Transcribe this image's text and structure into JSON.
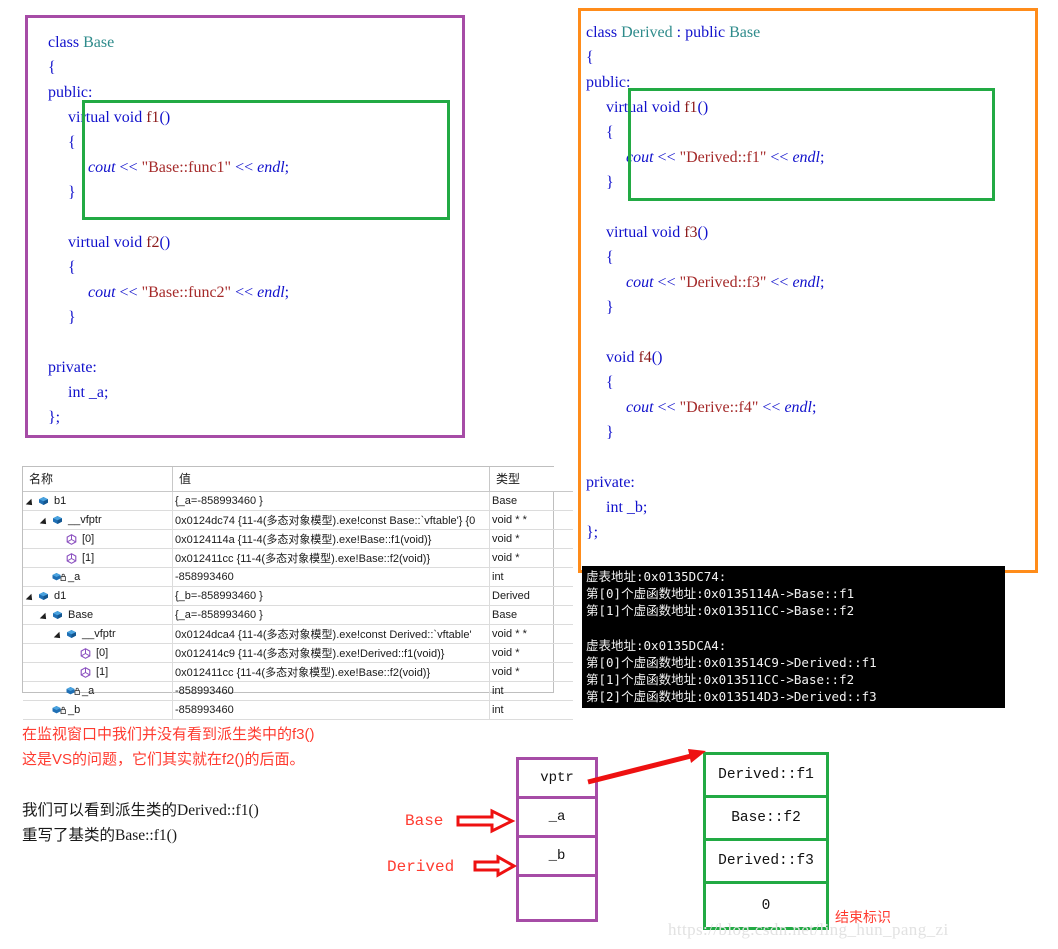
{
  "base_code": {
    "title": "class Base",
    "lines": [
      [
        {
          "t": "class ",
          "c": "kw"
        },
        {
          "t": "Base",
          "c": "type-id"
        }
      ],
      [
        {
          "t": "{",
          "c": "punct"
        }
      ],
      [
        {
          "t": "public",
          "c": "kw"
        },
        {
          "t": ":",
          "c": "punct"
        }
      ],
      [
        {
          "t": "     ",
          "c": "plain"
        },
        {
          "t": "virtual void ",
          "c": "kw"
        },
        {
          "t": "f1",
          "c": "fn"
        },
        {
          "t": "()",
          "c": "punct"
        }
      ],
      [
        {
          "t": "     {",
          "c": "punct"
        }
      ],
      [
        {
          "t": "          ",
          "c": "plain"
        },
        {
          "t": "cout",
          "c": "id"
        },
        {
          "t": " << ",
          "c": "op"
        },
        {
          "t": "\"Base::func1\"",
          "c": "str"
        },
        {
          "t": " << ",
          "c": "op"
        },
        {
          "t": "endl",
          "c": "id"
        },
        {
          "t": ";",
          "c": "punct"
        }
      ],
      [
        {
          "t": "     }",
          "c": "punct"
        }
      ],
      [
        {
          "t": "",
          "c": "plain"
        }
      ],
      [
        {
          "t": "     ",
          "c": "plain"
        },
        {
          "t": "virtual void ",
          "c": "kw"
        },
        {
          "t": "f2",
          "c": "fn"
        },
        {
          "t": "()",
          "c": "punct"
        }
      ],
      [
        {
          "t": "     {",
          "c": "punct"
        }
      ],
      [
        {
          "t": "          ",
          "c": "plain"
        },
        {
          "t": "cout",
          "c": "id"
        },
        {
          "t": " << ",
          "c": "op"
        },
        {
          "t": "\"Base::func2\"",
          "c": "str"
        },
        {
          "t": " << ",
          "c": "op"
        },
        {
          "t": "endl",
          "c": "id"
        },
        {
          "t": ";",
          "c": "punct"
        }
      ],
      [
        {
          "t": "     }",
          "c": "punct"
        }
      ],
      [
        {
          "t": "",
          "c": "plain"
        }
      ],
      [
        {
          "t": "private",
          "c": "kw"
        },
        {
          "t": ":",
          "c": "punct"
        }
      ],
      [
        {
          "t": "     ",
          "c": "plain"
        },
        {
          "t": "int ",
          "c": "kw"
        },
        {
          "t": "_a",
          "c": "plain"
        },
        {
          "t": ";",
          "c": "punct"
        }
      ],
      [
        {
          "t": "};",
          "c": "punct"
        }
      ]
    ]
  },
  "derived_code": {
    "title": "class Derived : public Base",
    "lines": [
      [
        {
          "t": "class ",
          "c": "kw"
        },
        {
          "t": "Derived",
          "c": "type-id"
        },
        {
          "t": " : ",
          "c": "punct"
        },
        {
          "t": "public ",
          "c": "kw"
        },
        {
          "t": "Base",
          "c": "type-id"
        }
      ],
      [
        {
          "t": "{",
          "c": "punct"
        }
      ],
      [
        {
          "t": "public",
          "c": "kw"
        },
        {
          "t": ":",
          "c": "punct"
        }
      ],
      [
        {
          "t": "     ",
          "c": "plain"
        },
        {
          "t": "virtual void ",
          "c": "kw"
        },
        {
          "t": "f1",
          "c": "fn"
        },
        {
          "t": "()",
          "c": "punct"
        }
      ],
      [
        {
          "t": "     {",
          "c": "punct"
        }
      ],
      [
        {
          "t": "          ",
          "c": "plain"
        },
        {
          "t": "cout",
          "c": "id"
        },
        {
          "t": " << ",
          "c": "op"
        },
        {
          "t": "\"Derived::f1\"",
          "c": "str"
        },
        {
          "t": " << ",
          "c": "op"
        },
        {
          "t": "endl",
          "c": "id"
        },
        {
          "t": ";",
          "c": "punct"
        }
      ],
      [
        {
          "t": "     }",
          "c": "punct"
        }
      ],
      [
        {
          "t": "",
          "c": "plain"
        }
      ],
      [
        {
          "t": "     ",
          "c": "plain"
        },
        {
          "t": "virtual void ",
          "c": "kw"
        },
        {
          "t": "f3",
          "c": "fn"
        },
        {
          "t": "()",
          "c": "punct"
        }
      ],
      [
        {
          "t": "     {",
          "c": "punct"
        }
      ],
      [
        {
          "t": "          ",
          "c": "plain"
        },
        {
          "t": "cout",
          "c": "id"
        },
        {
          "t": " << ",
          "c": "op"
        },
        {
          "t": "\"Derived::f3\"",
          "c": "str"
        },
        {
          "t": " << ",
          "c": "op"
        },
        {
          "t": "endl",
          "c": "id"
        },
        {
          "t": ";",
          "c": "punct"
        }
      ],
      [
        {
          "t": "     }",
          "c": "punct"
        }
      ],
      [
        {
          "t": "",
          "c": "plain"
        }
      ],
      [
        {
          "t": "     ",
          "c": "plain"
        },
        {
          "t": "void ",
          "c": "kw"
        },
        {
          "t": "f4",
          "c": "fn"
        },
        {
          "t": "()",
          "c": "punct"
        }
      ],
      [
        {
          "t": "     {",
          "c": "punct"
        }
      ],
      [
        {
          "t": "          ",
          "c": "plain"
        },
        {
          "t": "cout",
          "c": "id"
        },
        {
          "t": " << ",
          "c": "op"
        },
        {
          "t": "\"Derive::f4\"",
          "c": "str"
        },
        {
          "t": " << ",
          "c": "op"
        },
        {
          "t": "endl",
          "c": "id"
        },
        {
          "t": ";",
          "c": "punct"
        }
      ],
      [
        {
          "t": "     }",
          "c": "punct"
        }
      ],
      [
        {
          "t": "",
          "c": "plain"
        }
      ],
      [
        {
          "t": "private",
          "c": "kw"
        },
        {
          "t": ":",
          "c": "punct"
        }
      ],
      [
        {
          "t": "     ",
          "c": "plain"
        },
        {
          "t": "int ",
          "c": "kw"
        },
        {
          "t": "_b",
          "c": "plain"
        },
        {
          "t": ";",
          "c": "punct"
        }
      ],
      [
        {
          "t": "};",
          "c": "punct"
        }
      ]
    ]
  },
  "watch_window": {
    "columns": [
      "名称",
      "值",
      "类型"
    ],
    "rows": [
      {
        "indent": 0,
        "arrow": "open",
        "icon": "object-cube-icon",
        "name": "b1",
        "value": "{_a=-858993460 }",
        "type": "Base"
      },
      {
        "indent": 1,
        "arrow": "open",
        "icon": "object-cube-icon",
        "name": "__vfptr",
        "value": "0x0124dc74 {11-4(多态对象模型).exe!const Base::`vftable'} {0",
        "type": "void * *"
      },
      {
        "indent": 2,
        "arrow": "none",
        "icon": "pointer-hex-icon",
        "name": "[0]",
        "value": "0x0124114a {11-4(多态对象模型).exe!Base::f1(void)}",
        "type": "void *"
      },
      {
        "indent": 2,
        "arrow": "none",
        "icon": "pointer-hex-icon",
        "name": "[1]",
        "value": "0x012411cc {11-4(多态对象模型).exe!Base::f2(void)}",
        "type": "void *"
      },
      {
        "indent": 1,
        "arrow": "none",
        "icon": "private-field-icon",
        "name": "_a",
        "value": "-858993460",
        "type": "int"
      },
      {
        "indent": 0,
        "arrow": "open",
        "icon": "object-cube-icon",
        "name": "d1",
        "value": "{_b=-858993460 }",
        "type": "Derived"
      },
      {
        "indent": 1,
        "arrow": "open",
        "icon": "object-cube-icon",
        "name": "Base",
        "value": "{_a=-858993460 }",
        "type": "Base"
      },
      {
        "indent": 2,
        "arrow": "open",
        "icon": "object-cube-icon",
        "name": "__vfptr",
        "value": "0x0124dca4 {11-4(多态对象模型).exe!const Derived::`vftable'",
        "type": "void * *"
      },
      {
        "indent": 3,
        "arrow": "none",
        "icon": "pointer-hex-icon",
        "name": "[0]",
        "value": "0x012414c9 {11-4(多态对象模型).exe!Derived::f1(void)}",
        "type": "void *"
      },
      {
        "indent": 3,
        "arrow": "none",
        "icon": "pointer-hex-icon",
        "name": "[1]",
        "value": "0x012411cc {11-4(多态对象模型).exe!Base::f2(void)}",
        "type": "void *"
      },
      {
        "indent": 2,
        "arrow": "none",
        "icon": "private-field-icon",
        "name": "_a",
        "value": "-858993460",
        "type": "int"
      },
      {
        "indent": 1,
        "arrow": "none",
        "icon": "private-field-icon",
        "name": "_b",
        "value": "-858993460",
        "type": "int"
      }
    ]
  },
  "console": {
    "text": "虚表地址:0x0135DC74:\n第[0]个虚函数地址:0x0135114A->Base::f1\n第[1]个虚函数地址:0x013511CC->Base::f2\n\n虚表地址:0x0135DCA4:\n第[0]个虚函数地址:0x013514C9->Derived::f1\n第[1]个虚函数地址:0x013511CC->Base::f2\n第[2]个虚函数地址:0x013514D3->Derived::f3"
  },
  "notes": {
    "red": "在监视窗口中我们并没有看到派生类中的f3()\n这是VS的问题，它们其实就在f2()的后面。",
    "black": "我们可以看到派生类的Derived::f1()\n重写了基类的Base::f1()"
  },
  "diagram": {
    "object_layout": {
      "slots": [
        "vptr",
        "_a",
        "_b",
        ""
      ],
      "labels": {
        "base": "Base",
        "derived": "Derived"
      }
    },
    "vtable": {
      "slots": [
        "Derived::f1",
        "Base::f2",
        "Derived::f3",
        "0"
      ],
      "end_marker": "结束标识"
    }
  },
  "watermark": "https://blog.csdn.net/ling_hun_pang_zi",
  "colors": {
    "base_box_border": "#a64ca6",
    "derived_box_border": "#ff8c1a",
    "highlight_border": "#22aa44",
    "annotation_red": "#ff3b30",
    "arrow_red": "#ee1111",
    "console_bg": "#000000"
  }
}
